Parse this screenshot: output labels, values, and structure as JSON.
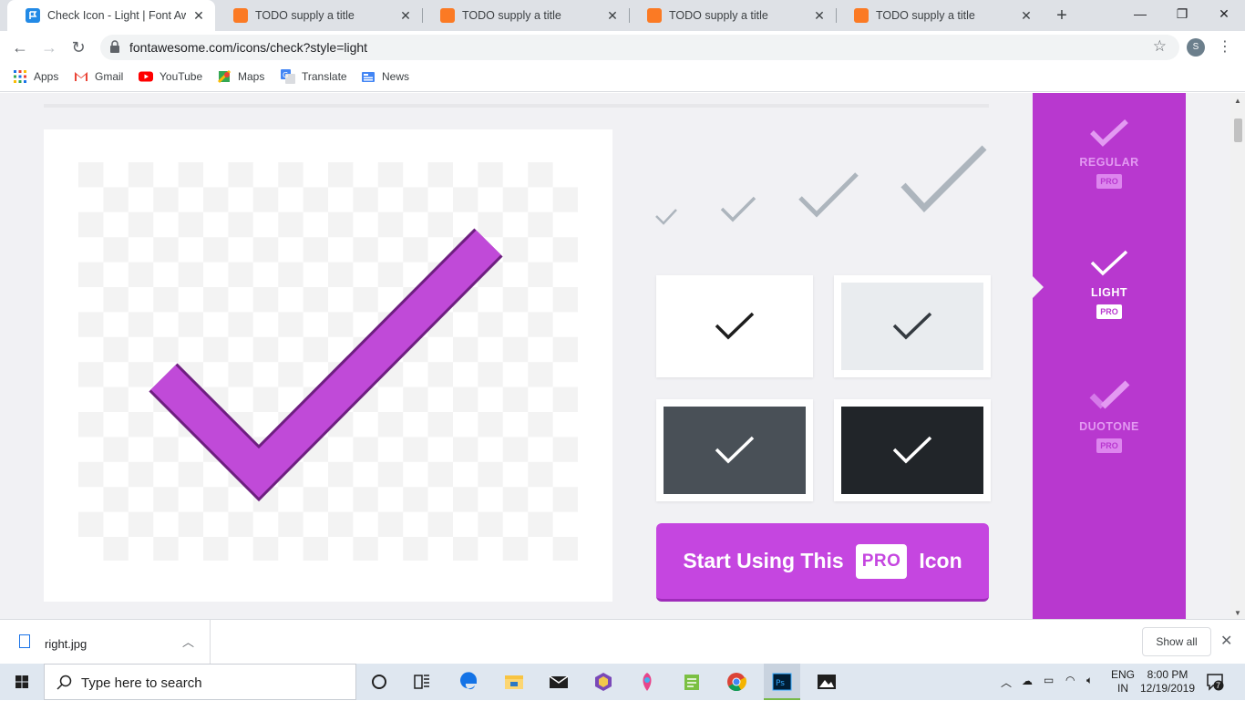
{
  "browser": {
    "tabs": [
      {
        "title": "Check Icon - Light | Font Awesome",
        "active": true
      },
      {
        "title": "TODO supply a title",
        "active": false
      },
      {
        "title": "TODO supply a title",
        "active": false
      },
      {
        "title": "TODO supply a title",
        "active": false
      },
      {
        "title": "TODO supply a title",
        "active": false
      }
    ],
    "url": "fontawesome.com/icons/check?style=light",
    "profile_initial": "S",
    "bookmarks": [
      "Apps",
      "Gmail",
      "YouTube",
      "Maps",
      "Translate",
      "News"
    ]
  },
  "page": {
    "styles": [
      {
        "label": "REGULAR",
        "badge": "PRO",
        "selected": false
      },
      {
        "label": "LIGHT",
        "badge": "PRO",
        "selected": true
      },
      {
        "label": "DUOTONE",
        "badge": "PRO",
        "selected": false
      }
    ],
    "cta": {
      "before": "Start Using This",
      "badge": "PRO",
      "after": "Icon"
    },
    "colors": {
      "accent": "#c546e0",
      "sidebar": "#b838cf",
      "icon_gray": "#adb5bd"
    }
  },
  "downloads": {
    "file": "right.jpg",
    "show_all": "Show all"
  },
  "taskbar": {
    "search_placeholder": "Type here to search",
    "lang_top": "ENG",
    "lang_bottom": "IN",
    "time": "8:00 PM",
    "date": "12/19/2019",
    "notifications": "7"
  }
}
